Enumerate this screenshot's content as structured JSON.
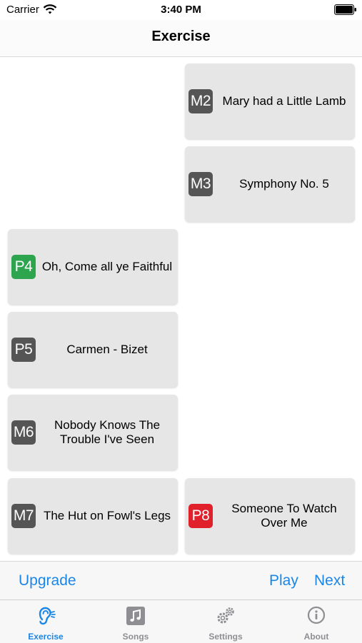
{
  "status_bar": {
    "carrier": "Carrier",
    "time": "3:40 PM"
  },
  "nav": {
    "title": "Exercise"
  },
  "cards": [
    {
      "badge": "M2",
      "title": "Mary had a Little Lamb",
      "badge_color": "#555555"
    },
    {
      "badge": "M3",
      "title": "Symphony No. 5",
      "badge_color": "#555555"
    },
    {
      "badge": "P4",
      "title": "Oh, Come all ye Faithful",
      "badge_color": "#2da44e"
    },
    {
      "badge": "P5",
      "title": "Carmen - Bizet",
      "badge_color": "#555555"
    },
    {
      "badge": "M6",
      "title": "Nobody Knows The Trouble I've Seen",
      "badge_color": "#555555"
    },
    {
      "badge": "M7",
      "title": "The Hut on Fowl's Legs",
      "badge_color": "#555555"
    },
    {
      "badge": "P8",
      "title": "Someone To Watch Over Me",
      "badge_color": "#e0202b"
    }
  ],
  "actions": {
    "upgrade": "Upgrade",
    "play": "Play",
    "next": "Next"
  },
  "tabs": [
    {
      "label": "Exercise",
      "icon": "ear-icon",
      "active": true
    },
    {
      "label": "Songs",
      "icon": "music-note-icon",
      "active": false
    },
    {
      "label": "Settings",
      "icon": "gears-icon",
      "active": false
    },
    {
      "label": "About",
      "icon": "info-icon",
      "active": false
    }
  ],
  "colors": {
    "accent": "#1a86e6",
    "card_bg": "#e6e6e6",
    "inactive_tab": "#8e8e93"
  }
}
